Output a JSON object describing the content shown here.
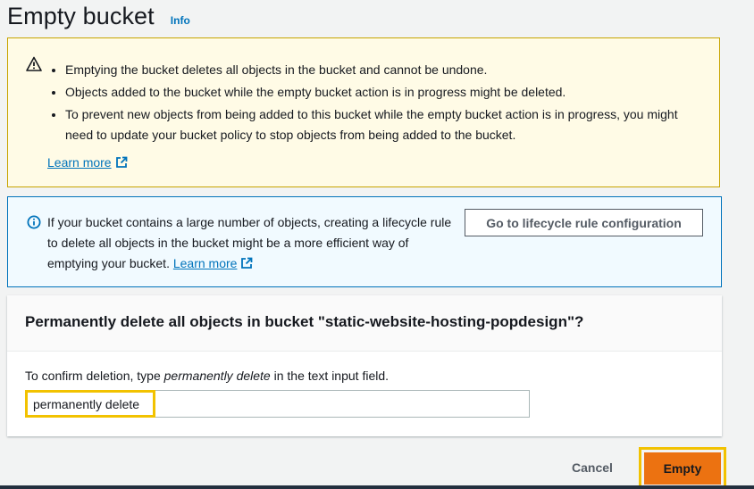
{
  "header": {
    "title": "Empty bucket",
    "info_label": "Info"
  },
  "warning": {
    "icon": "warning-icon",
    "bullets": [
      "Emptying the bucket deletes all objects in the bucket and cannot be undone.",
      "Objects added to the bucket while the empty bucket action is in progress might be deleted.",
      "To prevent new objects from being added to this bucket while the empty bucket action is in progress, you might need to update your bucket policy to stop objects from being added to the bucket."
    ],
    "learn_more": "Learn more"
  },
  "info": {
    "icon": "info-icon",
    "text": "If your bucket contains a large number of objects, creating a lifecycle rule to delete all objects in the bucket might be a more efficient way of emptying your bucket.",
    "learn_more": "Learn more",
    "button_label": "Go to lifecycle rule configuration"
  },
  "confirm": {
    "title": "Permanently delete all objects in bucket \"static-website-hosting-popdesign\"?",
    "label_prefix": "To confirm deletion, type ",
    "label_emphasis": "permanently delete",
    "label_suffix": " in the text input field.",
    "input_value": "permanently delete"
  },
  "footer": {
    "cancel_label": "Cancel",
    "empty_label": "Empty"
  },
  "colors": {
    "warning_border": "#c7a400",
    "warning_bg": "#fffbe6",
    "info_border": "#0073bb",
    "info_bg": "#f1faff",
    "primary_button": "#ec7211",
    "highlight": "#f2c200",
    "link": "#0073bb"
  }
}
